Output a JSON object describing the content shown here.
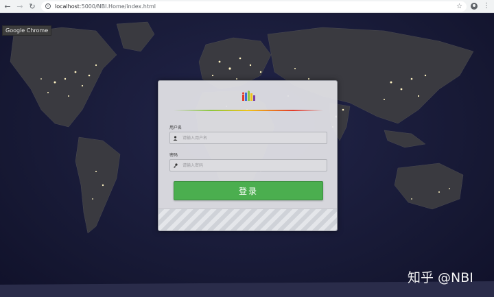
{
  "browser": {
    "url_host": "localhost",
    "url_path": ":5000/NBI.Home/index.html",
    "tooltip": "Google Chrome"
  },
  "login": {
    "username_label": "用户名",
    "username_placeholder": "请输入用户名",
    "password_label": "密码",
    "password_placeholder": "请输入密码",
    "submit_label": "登录"
  },
  "watermark": "知乎 @NBI",
  "icons": {
    "back": "arrow-left-icon",
    "forward": "arrow-right-icon",
    "reload": "reload-icon",
    "info": "info-icon",
    "star": "star-icon",
    "profile": "profile-icon",
    "menu": "kebab-menu-icon",
    "user": "user-icon",
    "key": "key-icon"
  },
  "colors": {
    "login_button": "#4bae4f",
    "map_background": "#1b1c36"
  }
}
